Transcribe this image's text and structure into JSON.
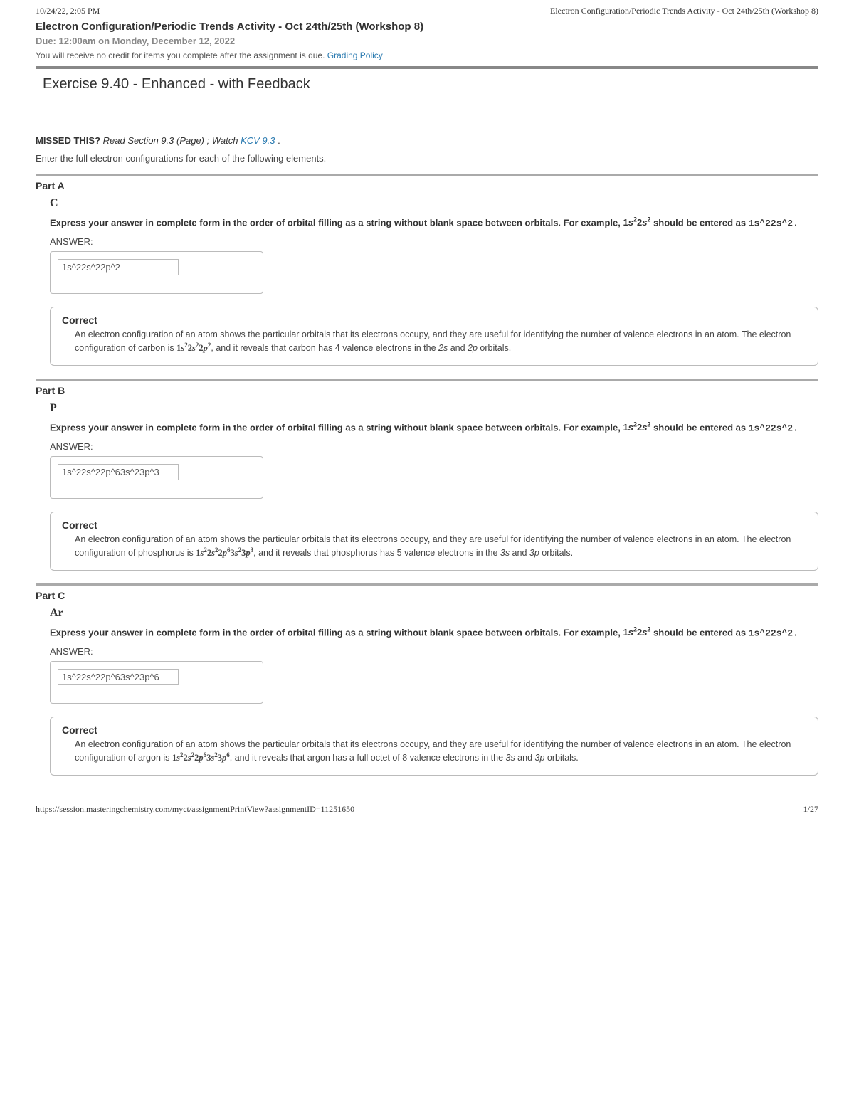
{
  "print_header": {
    "timestamp": "10/24/22, 2:05 PM",
    "doc_title": "Electron Configuration/Periodic Trends Activity - Oct 24th/25th (Workshop 8)"
  },
  "assignment": {
    "title": "Electron Configuration/Periodic Trends Activity - Oct 24th/25th (Workshop 8)",
    "due": "Due: 12:00am on Monday, December 12, 2022",
    "credit_prefix": "You will receive no credit for items you complete after the assignment is due. ",
    "credit_link": "Grading Policy"
  },
  "exercise": {
    "title": "Exercise 9.40 - Enhanced - with Feedback",
    "missed_label": "MISSED THIS?",
    "missed_read": " Read Section 9.3 (Page) ; Watch ",
    "missed_link": "KCV 9.3",
    "missed_period": " .",
    "instructions": "Enter the full electron configurations for each of the following elements."
  },
  "prompt_shared": {
    "line1_pre": "Express your answer in complete form in the order of orbital filling as a string without blank space between orbitals. For example, ",
    "line1_example_html": "1s²2s²",
    "line1_post": " should be entered as ",
    "line1_mono": "1s^22s^2.",
    "answer_label": "ANSWER:"
  },
  "parts": {
    "A": {
      "label": "Part A",
      "element": "C",
      "answer": "1s^22s^22p^2",
      "feedback_title": "Correct",
      "fb_pre": "An electron configuration of an atom shows the particular orbitals that its electrons occupy, and they are useful for identifying the number of valence electrons in an atom.  The electron configuration of carbon is ",
      "fb_config": "1s²2s²2p²",
      "fb_post_a": ", and it reveals that carbon has 4 valence electrons in the ",
      "fb_orb1": "2s",
      "fb_and": " and ",
      "fb_orb2": "2p",
      "fb_tail": " orbitals."
    },
    "B": {
      "label": "Part B",
      "element": "P",
      "answer": "1s^22s^22p^63s^23p^3",
      "feedback_title": "Correct",
      "fb_pre": "An electron configuration of an atom shows the particular orbitals that its electrons occupy, and they are useful for identifying the number of valence electrons in an atom. The electron configuration of phosphorus is ",
      "fb_config": "1s²2s²2p⁶3s²3p³",
      "fb_post_a": ", and it reveals that phosphorus has 5 valence electrons in the ",
      "fb_orb1": "3s",
      "fb_and": " and ",
      "fb_orb2": "3p",
      "fb_tail": " orbitals."
    },
    "C": {
      "label": "Part C",
      "element": "Ar",
      "answer": "1s^22s^22p^63s^23p^6",
      "feedback_title": "Correct",
      "fb_pre": "An electron configuration of an atom shows the particular orbitals that its electrons occupy, and they are useful for identifying the number of valence electrons in an atom. The electron configuration of argon is ",
      "fb_config": "1s²2s²2p⁶3s²3p⁶",
      "fb_post_a": ", and it reveals that argon has a full octet of 8 valence electrons in the ",
      "fb_orb1": "3s",
      "fb_and": " and ",
      "fb_orb2": "3p",
      "fb_tail": " orbitals."
    }
  },
  "footer": {
    "url": "https://session.masteringchemistry.com/myct/assignmentPrintView?assignmentID=11251650",
    "page": "1/27"
  }
}
